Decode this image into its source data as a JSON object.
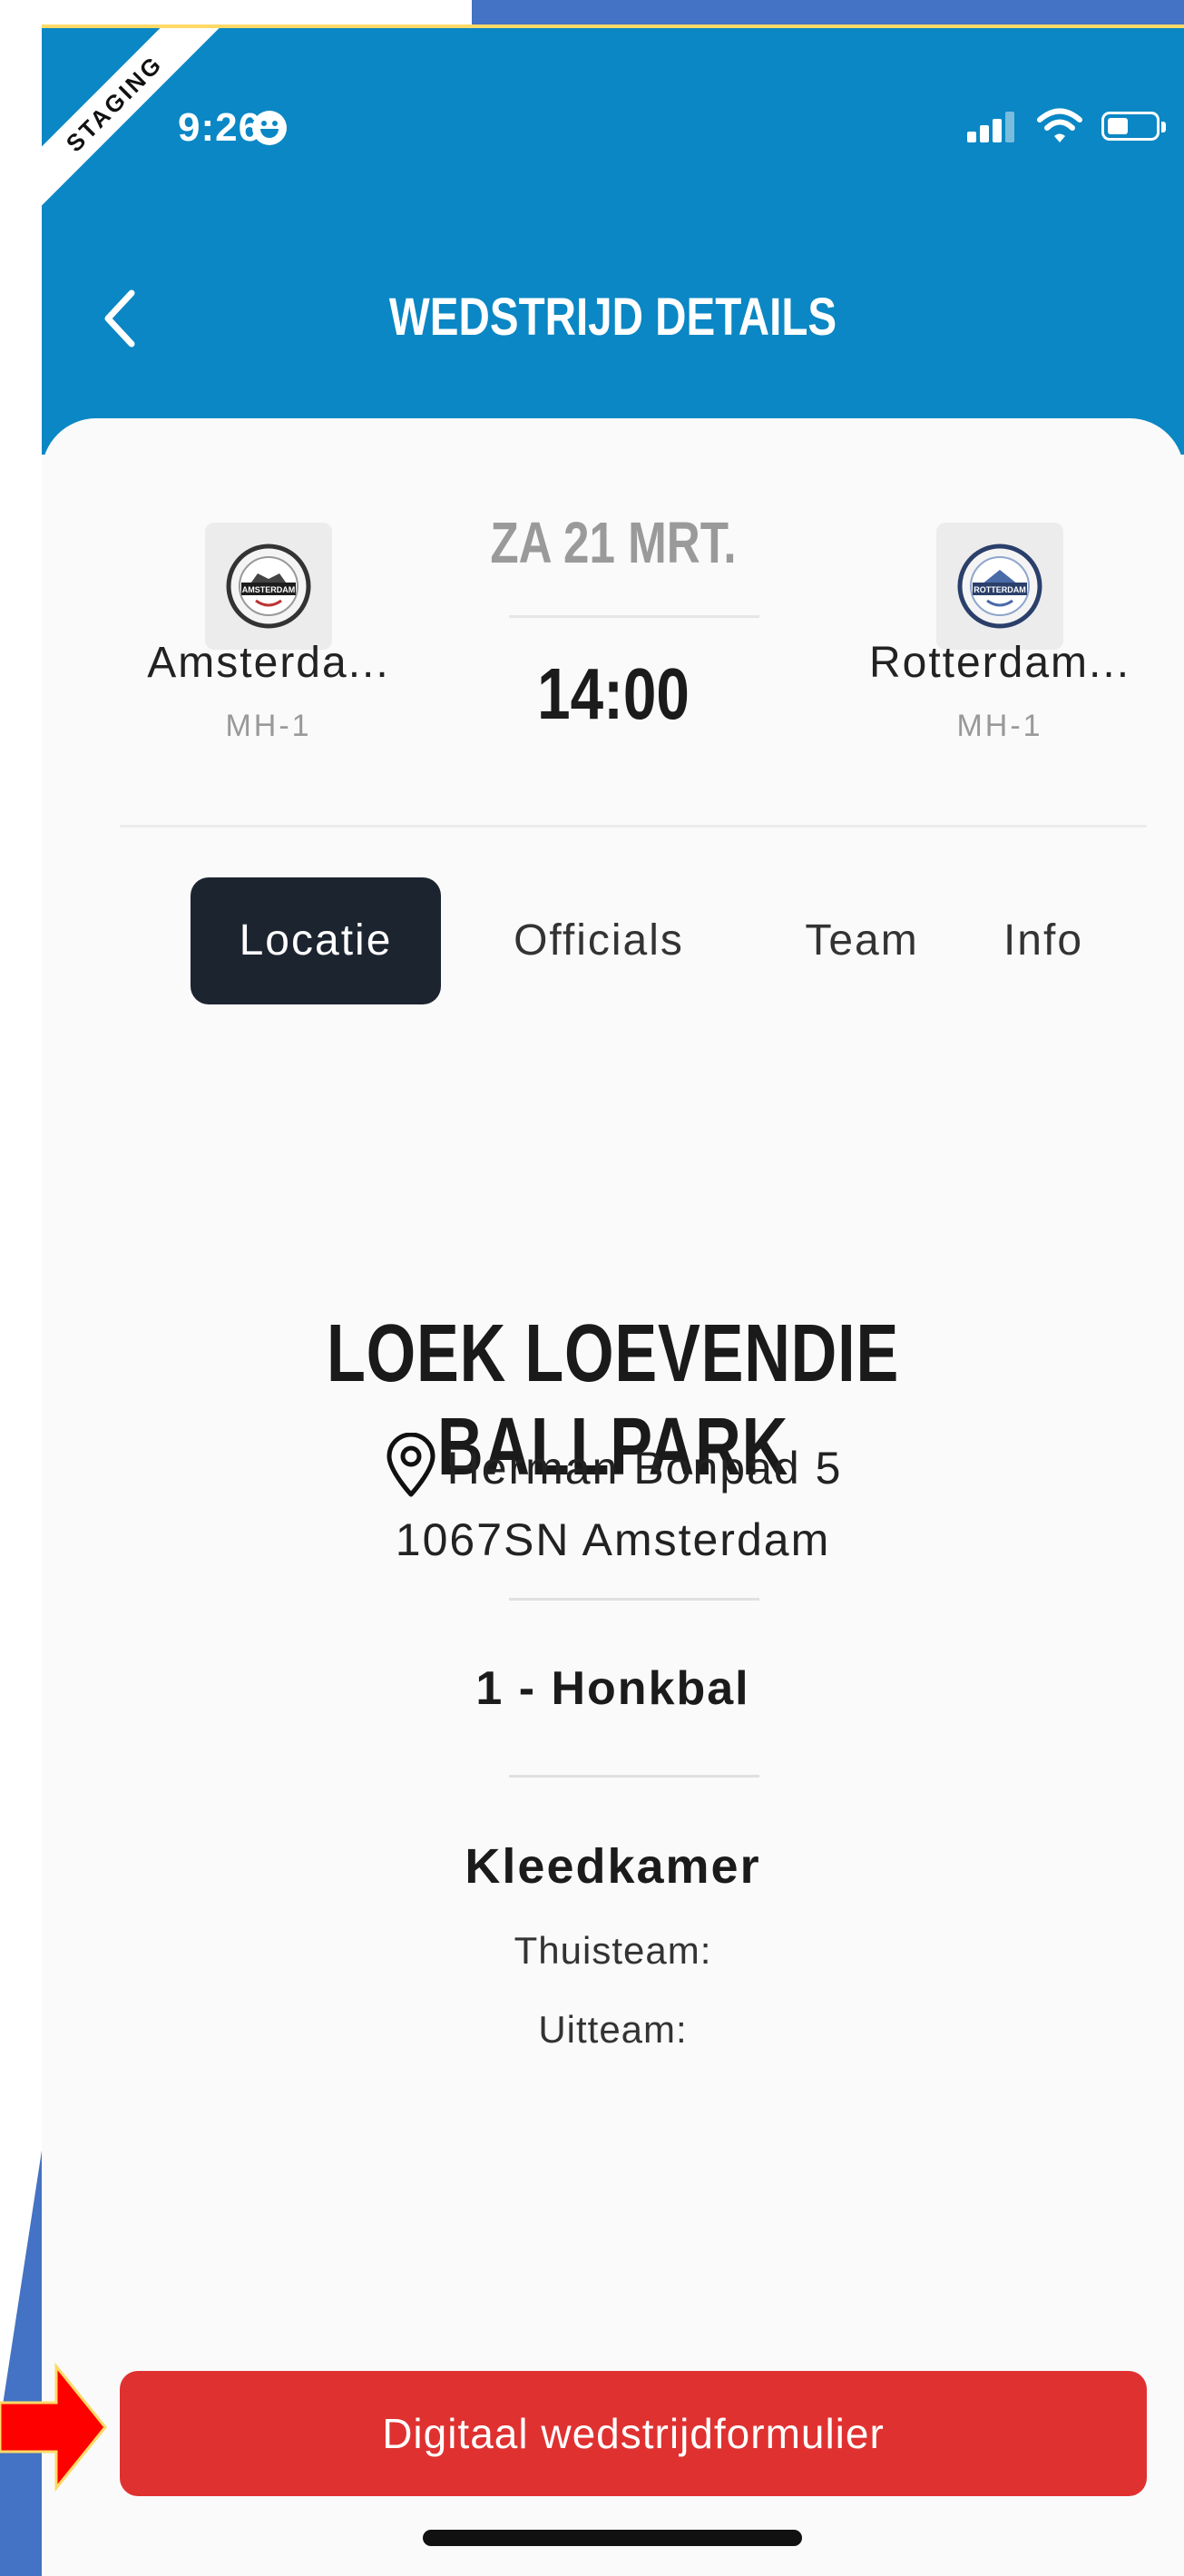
{
  "status_bar": {
    "time": "9:26",
    "staging_label": "STAGING"
  },
  "header": {
    "title": "WEDSTRIJD DETAILS"
  },
  "match": {
    "home": {
      "name": "Amsterda...",
      "code": "MH-1",
      "logo_text": "AMSTERDAM"
    },
    "away": {
      "name": "Rotterdam...",
      "code": "MH-1",
      "logo_text": "ROTTERDAM"
    },
    "date": "ZA 21 MRT.",
    "time": "14:00"
  },
  "tabs": [
    {
      "label": "Locatie",
      "active": true
    },
    {
      "label": "Officials",
      "active": false
    },
    {
      "label": "Team",
      "active": false
    },
    {
      "label": "Info",
      "active": false
    }
  ],
  "location": {
    "venue": "LOEK LOEVENDIE BALLPARK",
    "address_line1": "Herman Bonpad 5",
    "address_line2": "1067SN Amsterdam",
    "field": "1 - Honkbal",
    "locker_heading": "Kleedkamer",
    "home_locker": "Thuisteam:",
    "away_locker": "Uitteam:"
  },
  "cta": {
    "label": "Digitaal wedstrijdformulier"
  },
  "colors": {
    "header_blue": "#0a87c4",
    "active_tab": "#1c2430",
    "cta_red": "#e03131",
    "slide_blue": "#4472c4",
    "arrow_red": "#ff0000"
  },
  "icons": [
    "back-chevron-icon",
    "location-pin-icon",
    "signal-icon",
    "wifi-icon",
    "battery-icon"
  ]
}
